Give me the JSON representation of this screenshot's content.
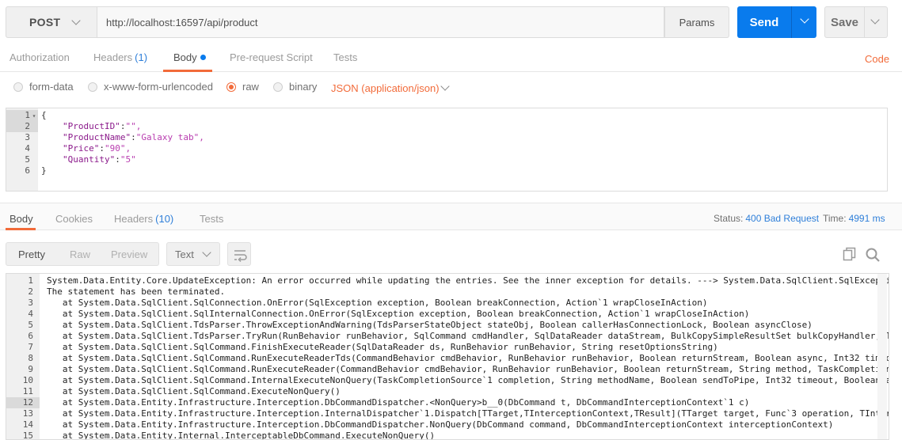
{
  "request": {
    "method": "POST",
    "url": "http://localhost:16597/api/product",
    "params_label": "Params",
    "send_label": "Send",
    "save_label": "Save"
  },
  "req_tabs": {
    "authorization": "Authorization",
    "headers": "Headers",
    "headers_count": "(1)",
    "body": "Body",
    "prerequest": "Pre-request Script",
    "tests": "Tests",
    "code": "Code"
  },
  "body_types": {
    "form_data": "form-data",
    "urlencoded": "x-www-form-urlencoded",
    "raw": "raw",
    "binary": "binary",
    "content_type": "JSON (application/json)",
    "selected": "raw"
  },
  "request_body": {
    "line_numbers": [
      "1",
      "2",
      "3",
      "4",
      "5",
      "6"
    ],
    "open_brace": "{",
    "close_brace": "}",
    "fields": [
      {
        "key": "\"ProductID\"",
        "value": "\"\","
      },
      {
        "key": "\"ProductName\"",
        "value": "\"Galaxy tab\","
      },
      {
        "key": "\"Price\"",
        "value": "\"90\","
      },
      {
        "key": "\"Quantity\"",
        "value": "\"5\""
      }
    ]
  },
  "res_tabs": {
    "body": "Body",
    "cookies": "Cookies",
    "headers": "Headers",
    "headers_count": "(10)",
    "tests": "Tests"
  },
  "status": {
    "status_label": "Status:",
    "status_value": "400 Bad Request",
    "time_label": "Time:",
    "time_value": "4991 ms"
  },
  "view": {
    "pretty": "Pretty",
    "raw": "Raw",
    "preview": "Preview",
    "format": "Text"
  },
  "response_body": {
    "lines": [
      {
        "n": "1",
        "t": "System.Data.Entity.Core.UpdateException: An error occurred while updating the entries. See the inner exception for details. ---> System.Data.SqlClient.SqlExcepti"
      },
      {
        "n": "2",
        "t": "The statement has been terminated."
      },
      {
        "n": "3",
        "t": "   at System.Data.SqlClient.SqlConnection.OnError(SqlException exception, Boolean breakConnection, Action`1 wrapCloseInAction)"
      },
      {
        "n": "4",
        "t": "   at System.Data.SqlClient.SqlInternalConnection.OnError(SqlException exception, Boolean breakConnection, Action`1 wrapCloseInAction)"
      },
      {
        "n": "5",
        "t": "   at System.Data.SqlClient.TdsParser.ThrowExceptionAndWarning(TdsParserStateObject stateObj, Boolean callerHasConnectionLock, Boolean asyncClose)"
      },
      {
        "n": "6",
        "t": "   at System.Data.SqlClient.TdsParser.TryRun(RunBehavior runBehavior, SqlCommand cmdHandler, SqlDataReader dataStream, BulkCopySimpleResultSet bulkCopyHandler, T"
      },
      {
        "n": "7",
        "t": "   at System.Data.SqlClient.SqlCommand.FinishExecuteReader(SqlDataReader ds, RunBehavior runBehavior, String resetOptionsString)"
      },
      {
        "n": "8",
        "t": "   at System.Data.SqlClient.SqlCommand.RunExecuteReaderTds(CommandBehavior cmdBehavior, RunBehavior runBehavior, Boolean returnStream, Boolean async, Int32 timeo"
      },
      {
        "n": "9",
        "t": "   at System.Data.SqlClient.SqlCommand.RunExecuteReader(CommandBehavior cmdBehavior, RunBehavior runBehavior, Boolean returnStream, String method, TaskCompletion"
      },
      {
        "n": "10",
        "t": "   at System.Data.SqlClient.SqlCommand.InternalExecuteNonQuery(TaskCompletionSource`1 completion, String methodName, Boolean sendToPipe, Int32 timeout, Boolean a"
      },
      {
        "n": "11",
        "t": "   at System.Data.SqlClient.SqlCommand.ExecuteNonQuery()"
      },
      {
        "n": "12",
        "t": "   at System.Data.Entity.Infrastructure.Interception.DbCommandDispatcher.<NonQuery>b__0(DbCommand t, DbCommandInterceptionContext`1 c)"
      },
      {
        "n": "13",
        "t": "   at System.Data.Entity.Infrastructure.Interception.InternalDispatcher`1.Dispatch[TTarget,TInterceptionContext,TResult](TTarget target, Func`3 operation, TInter"
      },
      {
        "n": "14",
        "t": "   at System.Data.Entity.Infrastructure.Interception.DbCommandDispatcher.NonQuery(DbCommand command, DbCommandInterceptionContext interceptionContext)"
      },
      {
        "n": "15",
        "t": "   at System.Data.Entity.Internal.InterceptableDbCommand.ExecuteNonQuery()"
      }
    ]
  }
}
